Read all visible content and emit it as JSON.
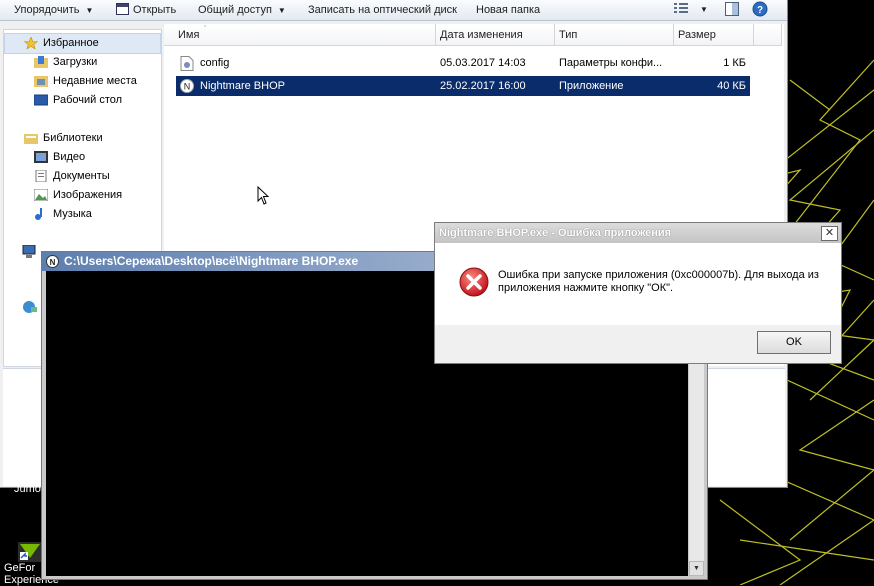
{
  "toolbar": {
    "organize": "Упорядочить",
    "open": "Открыть",
    "share": "Общий доступ",
    "burn": "Записать на оптический диск",
    "new_folder": "Новая папка"
  },
  "nav": {
    "favorites": "Избранное",
    "downloads": "Загрузки",
    "recent": "Недавние места",
    "desktop": "Рабочий стол",
    "libraries": "Библиотеки",
    "video": "Видео",
    "documents": "Документы",
    "images": "Изображения",
    "music": "Музыка"
  },
  "columns": {
    "name": "Имя",
    "date": "Дата изменения",
    "type": "Тип",
    "size": "Размер"
  },
  "files": [
    {
      "name": "config",
      "date": "05.03.2017 14:03",
      "type": "Параметры конфи...",
      "size": "1 КБ"
    },
    {
      "name": "Nightmare BHOP",
      "date": "25.02.2017 16:00",
      "type": "Приложение",
      "size": "40 КБ"
    }
  ],
  "console": {
    "title": "C:\\Users\\Сережа\\Desktop\\всё\\Nightmare BHOP.exe"
  },
  "dialog": {
    "title": "Nightmare BHOP.exe - Ошибка приложения",
    "message": "Ошибка при запуске приложения (0xc000007b). Для выхода из приложения нажмите кнопку \"ОК\".",
    "ok": "OK",
    "close": "✕"
  },
  "desktop": {
    "icon_label_1": "GeFor",
    "icon_label_2": "Experience",
    "fragment": "Jumo"
  },
  "colors": {
    "selection": "#0b2c6b",
    "wallpaper_line": "#d4d42a",
    "error_red": "#d8262e"
  }
}
